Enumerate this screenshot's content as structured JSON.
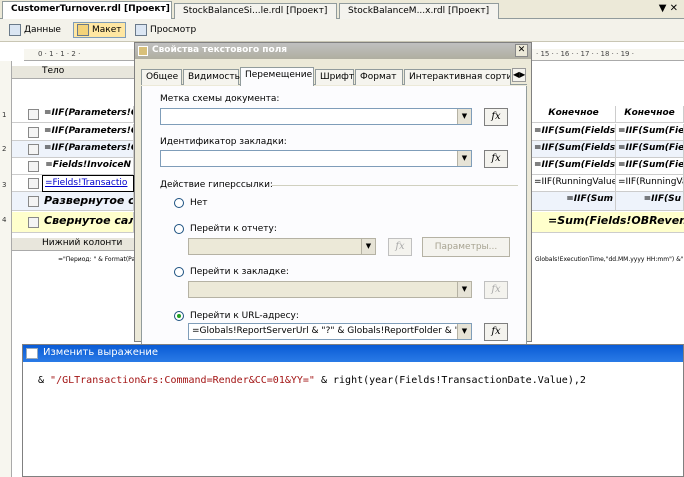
{
  "tabs": [
    {
      "label": "CustomerTurnover.rdl [Проект]",
      "active": true
    },
    {
      "label": "StockBalanceSi...le.rdl [Проект]"
    },
    {
      "label": "StockBalanceM...x.rdl [Проект]"
    }
  ],
  "tabstrip": {
    "controls": "▼ ✕"
  },
  "toolbar": {
    "data_label": "Данные",
    "layout_label": "Макет",
    "preview_label": "Просмотр"
  },
  "ruler": {
    "left": "0 · 1 · 1 · 2 ·",
    "right": "· 15 · · 16 · · 17 · · 18 · · 19 ·"
  },
  "vruler": [
    "1",
    "2",
    "3",
    "4"
  ],
  "report": {
    "body_band": "Тело",
    "footer_band": "Нижний колонти",
    "rows": [
      {
        "left": "=IIF(Parameters!G",
        "right1": "Конечное",
        "right2": "Конечное"
      },
      {
        "left": "=IIF(Parameters!C",
        "right1": "=IIF(Sum(Fields",
        "right2": "=IIF(Sum(Fiel"
      },
      {
        "left": "=IIF(Parameters!G",
        "right1": "=IIF(Sum(Fields!",
        "right2": "=IIF(Sum(Fiel"
      },
      {
        "left": "=Fields!InvoiceN",
        "right1": "=IIF(Sum(Fields!",
        "right2": "=IIF(Sum(Fiel"
      },
      {
        "left": "=Fields!Transactio",
        "right1": "=IIF(RunningValue(",
        "right2": "=IIF(RunningVal"
      },
      {
        "left": "Развернутое с",
        "right1": "=IIF(Sum",
        "right2": "=IIF(Su"
      },
      {
        "left": "Свернутое сал",
        "right1": "=Sum(Fields!OBRevenue.Va",
        "right2": ""
      }
    ],
    "footer_text_left": "=\"Период: \" & Format(Pa",
    "footer_text_right": "Globals!ExecutionTime,\"dd.MM.yyyy HH:mm\") &\" ."
  },
  "dialog": {
    "title": "Свойства текстового поля",
    "tabs": [
      "Общее",
      "Видимость",
      "Перемещение",
      "Шрифт",
      "Формат",
      "Интерактивная сорти"
    ],
    "active_tab": "Перемещение",
    "doc_map_label": "Метка схемы документа:",
    "bookmark_label": "Идентификатор закладки:",
    "hyperlink_label": "Действие гиперссылки:",
    "opt_none": "Нет",
    "opt_report": "Перейти к отчету:",
    "params_button": "Параметры...",
    "opt_bookmark": "Перейти к закладке:",
    "opt_url": "Перейти к URL-адресу:",
    "url_value": "=Globals!ReportServerUrl & \"?\" & Globals!ReportFolder & \"/GLTra",
    "fx": "fx"
  },
  "expression": {
    "title": "Изменить выражение",
    "line_prefix": "& ",
    "line_string": "\"/GLTransaction&rs:Command=Render&CC=01&YY=\"",
    "line_rest": " & right(year(Fields!TransactionDate.Value),2"
  },
  "colors": {
    "accent": "#0a5bd5",
    "selected_row": "#ffffcc",
    "band": "#e8e6dc"
  }
}
